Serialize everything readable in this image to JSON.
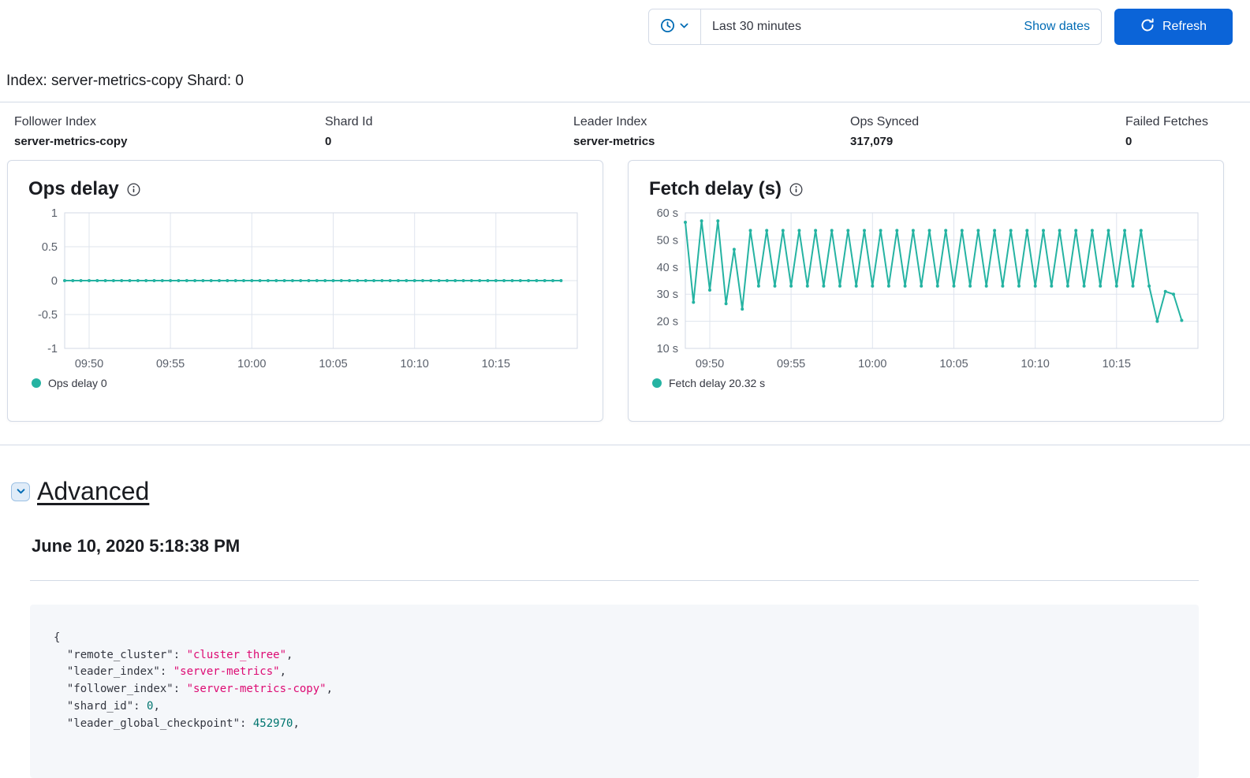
{
  "colors": {
    "primary": "#0b64d8",
    "link_blue": "#006bb4",
    "accent_teal": "#25b3a2",
    "code_string": "#dd0a73",
    "code_number": "#00756f",
    "border": "#d3dae6",
    "text": "#343741",
    "heading": "#1a1c21",
    "code_bg": "#f5f7fa",
    "chevron_badge_bg": "#e0ecf8"
  },
  "topbar": {
    "time_range": "Last 30 minutes",
    "show_dates_label": "Show dates",
    "refresh_label": "Refresh"
  },
  "page": {
    "title": "Index: server-metrics-copy Shard: 0"
  },
  "stats": [
    {
      "label": "Follower Index",
      "value": "server-metrics-copy"
    },
    {
      "label": "Shard Id",
      "value": "0"
    },
    {
      "label": "Leader Index",
      "value": "server-metrics"
    },
    {
      "label": "Ops Synced",
      "value": "317,079"
    },
    {
      "label": "Failed Fetches",
      "value": "0"
    }
  ],
  "chart_data": [
    {
      "type": "line",
      "title": "Ops delay",
      "legend": "Ops delay 0",
      "color": "#25b3a2",
      "x_ticks": [
        "09:50",
        "09:55",
        "10:00",
        "10:05",
        "10:10",
        "10:15"
      ],
      "x_tick_positions": [
        3,
        13,
        23,
        33,
        43,
        53
      ],
      "x_domain": [
        0,
        63
      ],
      "ylim": [
        -1,
        1
      ],
      "y_ticks": [
        "1",
        "0.5",
        "0",
        "-0.5",
        "-1"
      ],
      "y_tick_values": [
        1,
        0.5,
        0,
        -0.5,
        -1
      ],
      "grid": true,
      "legend_position": "bottom",
      "values": [
        0,
        0,
        0,
        0,
        0,
        0,
        0,
        0,
        0,
        0,
        0,
        0,
        0,
        0,
        0,
        0,
        0,
        0,
        0,
        0,
        0,
        0,
        0,
        0,
        0,
        0,
        0,
        0,
        0,
        0,
        0,
        0,
        0,
        0,
        0,
        0,
        0,
        0,
        0,
        0,
        0,
        0,
        0,
        0,
        0,
        0,
        0,
        0,
        0,
        0,
        0,
        0,
        0,
        0,
        0,
        0,
        0,
        0,
        0,
        0,
        0,
        0
      ]
    },
    {
      "type": "line",
      "title": "Fetch delay (s)",
      "legend": "Fetch delay 20.32 s",
      "color": "#25b3a2",
      "x_ticks": [
        "09:50",
        "09:55",
        "10:00",
        "10:05",
        "10:10",
        "10:15"
      ],
      "x_tick_positions": [
        3,
        13,
        23,
        33,
        43,
        53
      ],
      "x_domain": [
        0,
        63
      ],
      "ylim": [
        10,
        60
      ],
      "y_ticks": [
        "60 s",
        "50 s",
        "40 s",
        "30 s",
        "20 s",
        "10 s"
      ],
      "y_tick_values": [
        60,
        50,
        40,
        30,
        20,
        10
      ],
      "grid": true,
      "legend_position": "bottom",
      "values": [
        56.5,
        27,
        57,
        31.5,
        57,
        26.5,
        46.5,
        24.5,
        53.5,
        33,
        53.5,
        33,
        53.5,
        33,
        53.5,
        33,
        53.5,
        33,
        53.5,
        33,
        53.5,
        33,
        53.5,
        33,
        53.5,
        33,
        53.5,
        33,
        53.5,
        33,
        53.5,
        33,
        53.5,
        33,
        53.5,
        33,
        53.5,
        33,
        53.5,
        33,
        53.5,
        33,
        53.5,
        33,
        53.5,
        33,
        53.5,
        33,
        53.5,
        33,
        53.5,
        33,
        53.5,
        33,
        53.5,
        33,
        53.5,
        33,
        20,
        31,
        30,
        20.32
      ]
    }
  ],
  "advanced": {
    "title": "Advanced",
    "timestamp": "June 10, 2020 5:18:38 PM",
    "code_lines": [
      [
        {
          "text": "{",
          "type": "plain"
        }
      ],
      [
        {
          "text": "  \"remote_cluster\": ",
          "type": "plain"
        },
        {
          "text": "\"cluster_three\"",
          "type": "string"
        },
        {
          "text": ",",
          "type": "plain"
        }
      ],
      [
        {
          "text": "  \"leader_index\": ",
          "type": "plain"
        },
        {
          "text": "\"server-metrics\"",
          "type": "string"
        },
        {
          "text": ",",
          "type": "plain"
        }
      ],
      [
        {
          "text": "  \"follower_index\": ",
          "type": "plain"
        },
        {
          "text": "\"server-metrics-copy\"",
          "type": "string"
        },
        {
          "text": ",",
          "type": "plain"
        }
      ],
      [
        {
          "text": "  \"shard_id\": ",
          "type": "plain"
        },
        {
          "text": "0",
          "type": "number"
        },
        {
          "text": ",",
          "type": "plain"
        }
      ],
      [
        {
          "text": "  \"leader_global_checkpoint\": ",
          "type": "plain"
        },
        {
          "text": "452970",
          "type": "number"
        },
        {
          "text": ",",
          "type": "plain"
        }
      ]
    ]
  }
}
